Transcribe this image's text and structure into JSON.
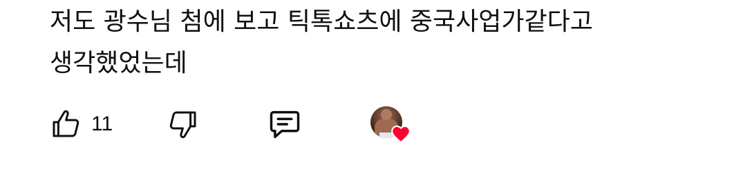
{
  "comment": {
    "text": "저도 광수님 첨에 보고 틱톡쇼츠에 중국사업가같다고 생각했었는데"
  },
  "actions": {
    "like_count": "11",
    "like_icon": "thumbs-up-icon",
    "dislike_icon": "thumbs-down-icon",
    "reply_icon": "comment-bubble-icon",
    "creator_heart_icon": "heart-icon"
  },
  "colors": {
    "text": "#0f0f0f",
    "heart": "#ff0033",
    "background": "#ffffff"
  }
}
